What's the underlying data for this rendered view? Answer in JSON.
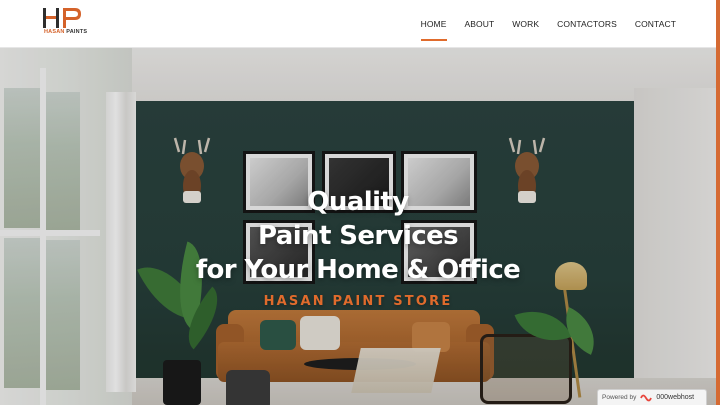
{
  "brand": {
    "logo_text_part1": "HASAN",
    "logo_text_part2": "PAINTS",
    "accent_color": "#e06b2c"
  },
  "nav": {
    "items": [
      {
        "label": "HOME",
        "active": true
      },
      {
        "label": "ABOUT",
        "active": false
      },
      {
        "label": "WORK",
        "active": false
      },
      {
        "label": "CONTACTORS",
        "active": false
      },
      {
        "label": "CONTACT",
        "active": false
      }
    ]
  },
  "hero": {
    "title_line1": "Quality",
    "title_line2": "Paint Services",
    "title_line3": "for Your Home & Office",
    "subtitle": "HASAN PAINT STORE"
  },
  "badge": {
    "label": "Powered by",
    "host": "000webhost",
    "icon": "000webhost-logo-icon"
  }
}
